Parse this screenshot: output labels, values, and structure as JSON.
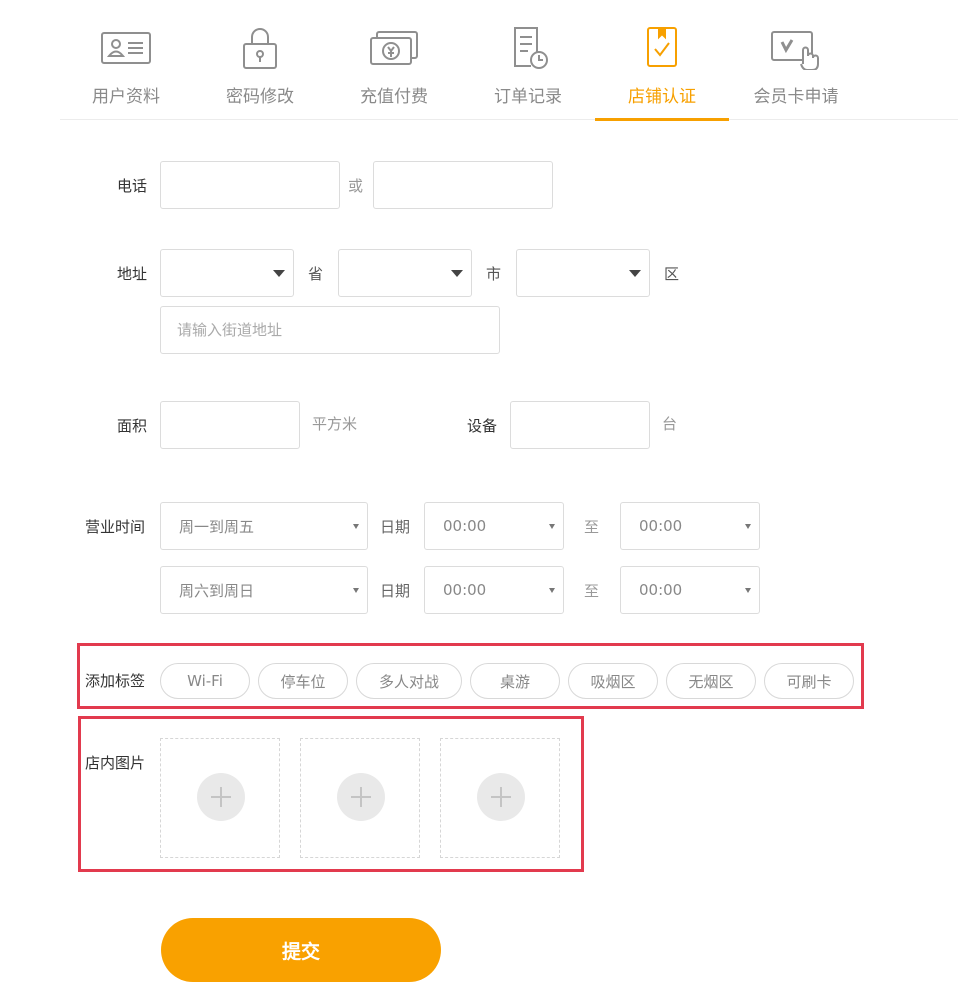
{
  "tabs": [
    {
      "label": "用户资料",
      "icon": "id-card-icon"
    },
    {
      "label": "密码修改",
      "icon": "padlock-icon"
    },
    {
      "label": "充值付费",
      "icon": "money-icon"
    },
    {
      "label": "订单记录",
      "icon": "order-clock-icon"
    },
    {
      "label": "店铺认证",
      "icon": "bookmark-check-icon",
      "active": true
    },
    {
      "label": "会员卡申请",
      "icon": "card-hand-icon"
    }
  ],
  "colors": {
    "accent": "#f7a000",
    "highlight_frame": "#e23a4e"
  },
  "form": {
    "phone": {
      "label": "电话",
      "or": "或",
      "value1": "",
      "value2": ""
    },
    "address": {
      "label": "地址",
      "province_unit": "省",
      "city_unit": "市",
      "district_unit": "区",
      "street_placeholder": "请输入街道地址"
    },
    "area": {
      "label": "面积",
      "unit": "平方米",
      "value": ""
    },
    "device": {
      "label": "设备",
      "unit": "台",
      "value": ""
    },
    "hours": {
      "label": "营业时间",
      "rows": [
        {
          "days": "周一到周五",
          "date_label": "日期",
          "start": "00:00",
          "to": "至",
          "end": "00:00"
        },
        {
          "days": "周六到周日",
          "date_label": "日期",
          "start": "00:00",
          "to": "至",
          "end": "00:00"
        }
      ]
    },
    "tags": {
      "label": "添加标签",
      "items": [
        "Wi-Fi",
        "停车位",
        "多人对战",
        "桌游",
        "吸烟区",
        "无烟区",
        "可刷卡"
      ]
    },
    "photos": {
      "label": "店内图片",
      "slots": 3
    },
    "submit_label": "提交"
  }
}
